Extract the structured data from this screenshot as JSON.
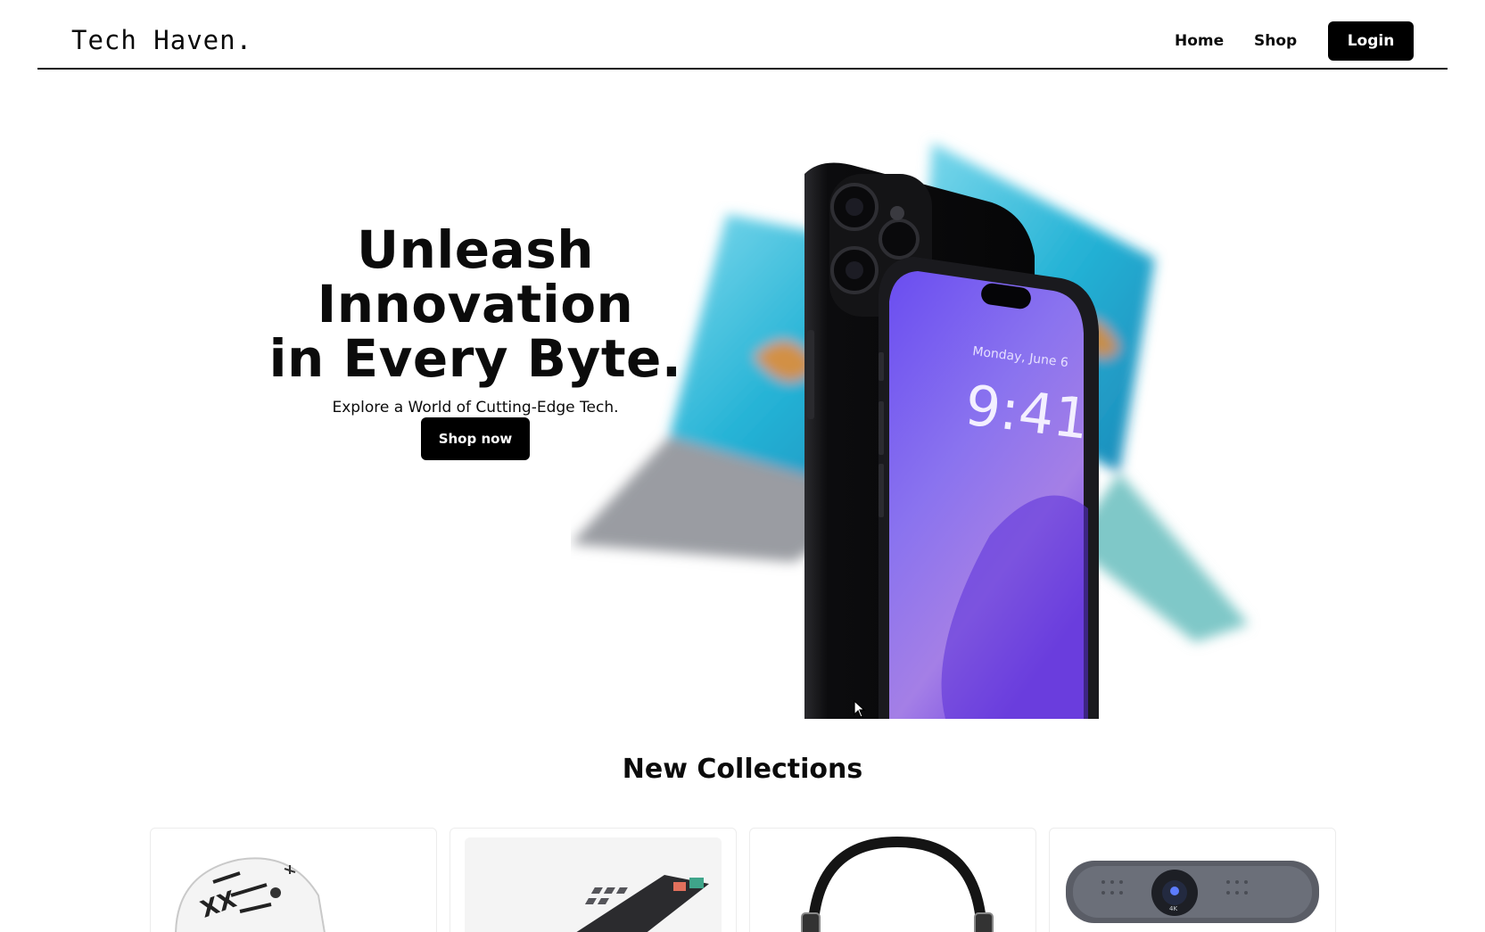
{
  "header": {
    "brand": "Tech Haven.",
    "nav": [
      {
        "label": "Home"
      },
      {
        "label": "Shop"
      }
    ],
    "login_label": "Login"
  },
  "hero": {
    "title_line1": "Unleash Innovation",
    "title_line2": "in Every Byte.",
    "subtitle": "Explore a World of Cutting-Edge Tech.",
    "cta_label": "Shop now",
    "phone_lock_date": "Monday, June 6",
    "phone_lock_time": "9:41"
  },
  "collections": {
    "title": "New Collections",
    "products": [
      {
        "icon": "gaming-mouse-icon"
      },
      {
        "icon": "mechanical-keyboard-icon"
      },
      {
        "icon": "headphones-icon"
      },
      {
        "icon": "webcam-speaker-bar-icon",
        "badge": "4K"
      }
    ]
  },
  "colors": {
    "accent": "#000000",
    "background": "#ffffff",
    "text": "#0b0b0b",
    "laptop_screen": "#2fb8d8",
    "phone_screen": "#7b5cf0"
  }
}
